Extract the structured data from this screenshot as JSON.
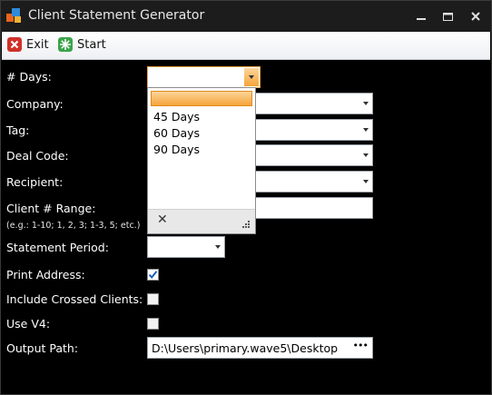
{
  "window": {
    "title": "Client Statement Generator"
  },
  "toolbar": {
    "exit_label": "Exit",
    "start_label": "Start"
  },
  "form": {
    "days_label": "# Days:",
    "company_label": "Company:",
    "tag_label": "Tag:",
    "deal_code_label": "Deal Code:",
    "recipient_label": "Recipient:",
    "client_range_label": "Client # Range:",
    "client_range_hint": "(e.g.: 1-10; 1, 2, 3; 1-3, 5; etc.)",
    "statement_period_label": "Statement Period:",
    "print_address_label": "Print Address:",
    "include_crossed_label": "Include Crossed Clients:",
    "use_v4_label": "Use V4:",
    "output_path_label": "Output Path:",
    "output_path_value": "D:\\Users\\primary.wave5\\Desktop",
    "browse_label": "•••",
    "print_address_checked": true,
    "include_crossed_checked": false,
    "use_v4_checked": false
  },
  "days_dropdown": {
    "options": [
      "",
      "45 Days",
      "60 Days",
      "90 Days"
    ],
    "clear_label": "✕"
  },
  "colors": {
    "accent_orange": "#f6a43a",
    "title_bar": "#1c1c1c",
    "background": "#000000",
    "check_blue": "#1f5fbf"
  }
}
